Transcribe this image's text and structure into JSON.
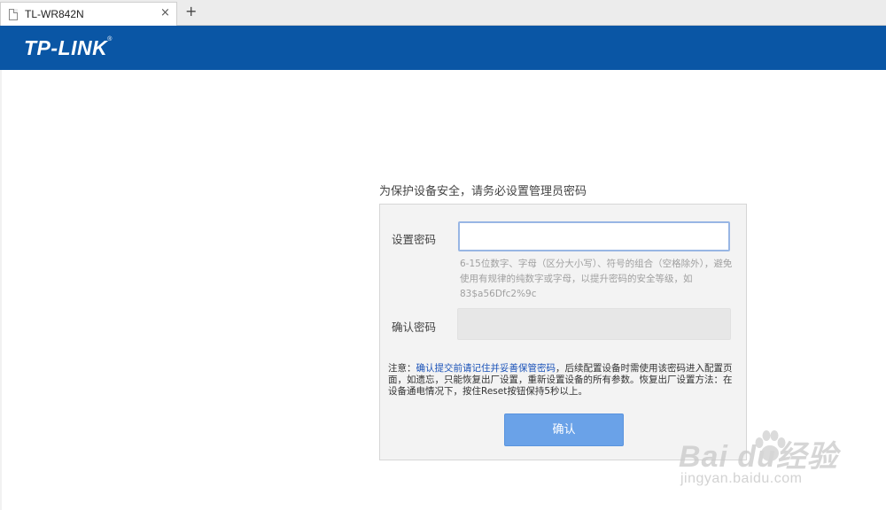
{
  "browser": {
    "tab_title": "TL-WR842N",
    "tab_close": "×",
    "new_tab": "+"
  },
  "header": {
    "logo_text": "TP-LINK",
    "logo_tm": "®",
    "brand_color": "#0a56a5"
  },
  "form": {
    "intro": "为保护设备安全，请务必设置管理员密码",
    "password_label": "设置密码",
    "password_value": "",
    "hint": "6-15位数字、字母（区分大小写）、符号的组合（空格除外），避免使用有规律的纯数字或字母，以提升密码的安全等级，如83$a56Dfc2%9c",
    "confirm_label": "确认密码",
    "confirm_value": "",
    "note_prefix": "注意：",
    "note_emphasis": "确认提交前请记住并妥善保管密码",
    "note_rest": "，后续配置设备时需使用该密码进入配置页面，如遗忘，只能恢复出厂设置，重新设置设备的所有参数。恢复出厂设置方法：在设备通电情况下，按住Reset按钮保持5秒以上。",
    "submit_label": "确认",
    "button_color": "#6aa2e8"
  },
  "watermark": {
    "main": "Bai  du经验",
    "sub": "jingyan.baidu.com"
  }
}
